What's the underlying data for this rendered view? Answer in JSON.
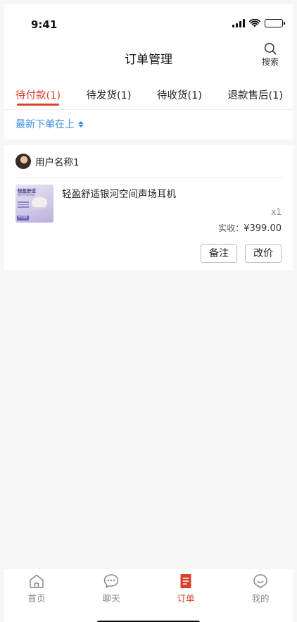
{
  "status_bar": {
    "time": "9:41"
  },
  "header": {
    "title": "订单管理",
    "search_label": "搜索"
  },
  "tabs": [
    {
      "label": "待付款(1)",
      "active": true
    },
    {
      "label": "待发货(1)",
      "active": false
    },
    {
      "label": "待收货(1)",
      "active": false
    },
    {
      "label": "退款售后(1)",
      "active": false
    }
  ],
  "sort": {
    "label": "最新下单在上"
  },
  "order": {
    "user_name": "用户名称1",
    "product": {
      "name": "轻盈舒适银河空间声场耳机",
      "image_title": "轻盈舒适",
      "image_subtitle": "银河空间声场",
      "image_price": "¥399",
      "quantity": "x1",
      "paid_label": "实收：",
      "paid_amount": "¥399.00"
    },
    "actions": {
      "note": "备注",
      "change_price": "改价"
    }
  },
  "tabbar": [
    {
      "label": "首页",
      "icon": "home-icon",
      "active": false
    },
    {
      "label": "聊天",
      "icon": "chat-icon",
      "active": false
    },
    {
      "label": "订单",
      "icon": "order-icon",
      "active": true
    },
    {
      "label": "我的",
      "icon": "profile-icon",
      "active": false
    }
  ],
  "colors": {
    "accent": "#d9422e",
    "link": "#3a8ee6",
    "background": "#f7f7f8"
  }
}
